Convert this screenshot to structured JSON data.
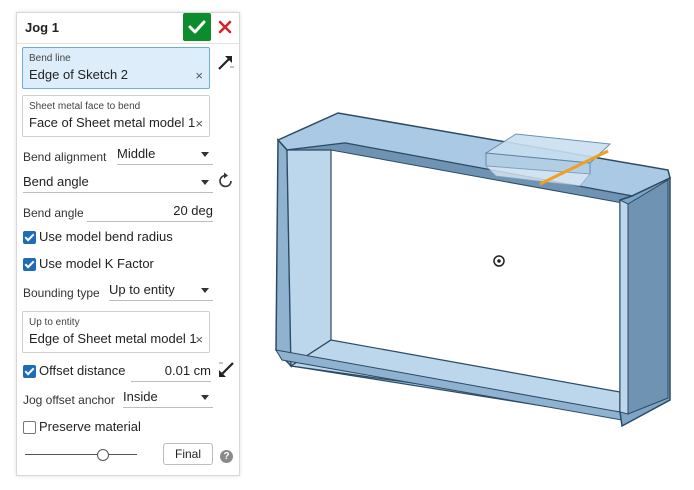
{
  "panel": {
    "title": "Jog 1",
    "bend_line": {
      "label": "Bend line",
      "value": "Edge of Sketch 2",
      "clear": "×"
    },
    "face": {
      "label": "Sheet metal face to bend",
      "value": "Face of Sheet metal model 1",
      "clear": "×"
    },
    "bend_alignment": {
      "label": "Bend alignment",
      "value": "Middle"
    },
    "bend_mode": {
      "value": "Bend angle"
    },
    "bend_angle": {
      "label": "Bend angle",
      "value": "20 deg"
    },
    "use_model_bend_radius": {
      "label": "Use model bend radius",
      "checked": true
    },
    "use_model_k_factor": {
      "label": "Use model K Factor",
      "checked": true
    },
    "bounding_type": {
      "label": "Bounding type",
      "value": "Up to entity"
    },
    "up_to_entity": {
      "label": "Up to entity",
      "value": "Edge of Sheet metal model 1",
      "clear": "×"
    },
    "offset_distance": {
      "label": "Offset distance",
      "value": "0.01 cm",
      "checked": true
    },
    "jog_offset_anchor": {
      "label": "Jog offset anchor",
      "value": "Inside"
    },
    "preserve_material": {
      "label": "Preserve material",
      "checked": false
    },
    "slider": {
      "value_fraction": 0.72
    },
    "final_button": "Final",
    "help": "?"
  },
  "colors": {
    "accept": "#0d8c2d",
    "cancel": "#d3242a",
    "selection_bg": "#ddeefa",
    "checkbox": "#1e6bb8",
    "model_face": "#a9c9e4",
    "model_edge": "#2d4a63",
    "bend_line": "#f0a020"
  },
  "icons": [
    "check-icon",
    "close-icon",
    "flip-arrow-icon",
    "rotate-icon",
    "opposite-direction-icon",
    "help-icon",
    "origin-marker-icon"
  ]
}
